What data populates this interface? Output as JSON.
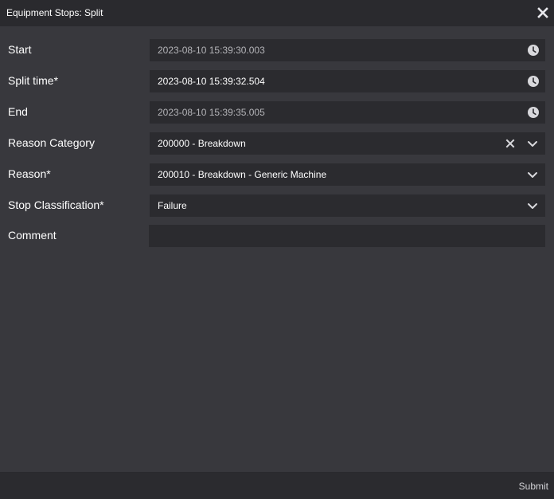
{
  "dialog": {
    "title": "Equipment Stops: Split",
    "close_icon": "close-icon"
  },
  "fields": {
    "start": {
      "label": "Start",
      "value": "2023-08-10 15:39:30.003",
      "icon": "clock-icon",
      "readonly": true
    },
    "split_time": {
      "label": "Split time*",
      "value": "2023-08-10 15:39:32.504",
      "icon": "clock-icon",
      "readonly": false
    },
    "end": {
      "label": "End",
      "value": "2023-08-10 15:39:35.005",
      "icon": "clock-icon",
      "readonly": true
    },
    "reason_category": {
      "label": "Reason Category",
      "value": "200000 - Breakdown",
      "icons": [
        "clear-icon",
        "chevron-down-icon"
      ]
    },
    "reason": {
      "label": "Reason*",
      "value": "200010 - Breakdown - Generic Machine",
      "icon": "chevron-down-icon"
    },
    "stop_classification": {
      "label": "Stop Classification*",
      "value": "Failure",
      "icon": "chevron-down-icon"
    },
    "comment": {
      "label": "Comment",
      "value": "",
      "placeholder": ""
    }
  },
  "footer": {
    "submit_label": "Submit"
  },
  "colors": {
    "background": "#38383d",
    "titlebar": "#2a2a2e",
    "field_bg": "#2b2b2f",
    "text": "#ffffff",
    "readonly_text": "#b4b4b8",
    "icon": "#d8d8dc"
  }
}
